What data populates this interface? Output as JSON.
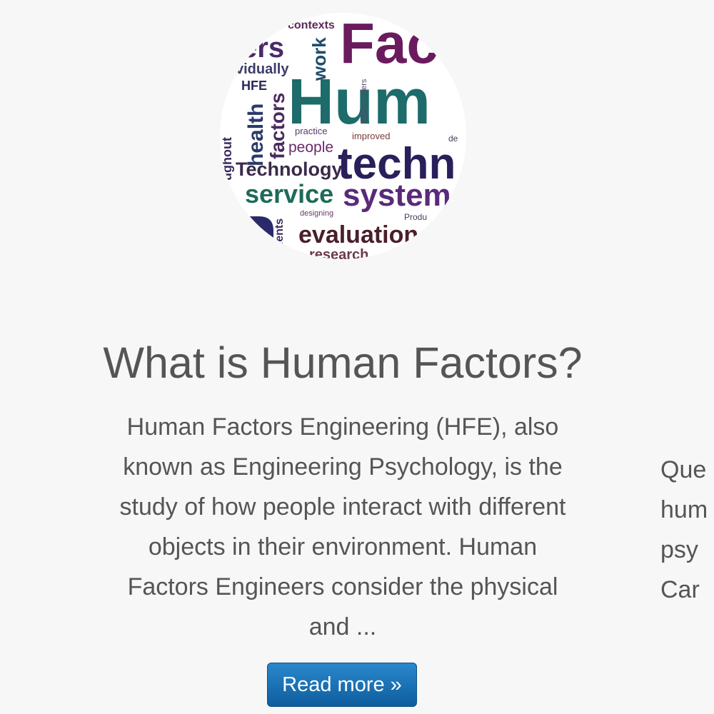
{
  "colors": {
    "page_background": "#f7f7f7",
    "text": "#555555",
    "button": "#1b71b4",
    "button_text": "#ffffff"
  },
  "featured": {
    "image": {
      "type": "word-cloud",
      "words": [
        "contexts",
        "Fac",
        "ers",
        "work",
        "vidually",
        "HFE",
        "Hum",
        "stakeholders",
        "health",
        "factors",
        "practice",
        "improved",
        "people",
        "Technology",
        "techn",
        "ughout",
        "service",
        "system",
        "designing",
        "Produ",
        "ments",
        "evaluation",
        "research",
        "de"
      ]
    },
    "title": "What is Human Factors?",
    "body_lines": [
      "Human Factors Engineering (HFE), also",
      "known as Engineering Psychology, is the",
      "study of how people interact with different",
      "objects in their environment. Human",
      "Factors Engineers consider the physical",
      "and ..."
    ],
    "read_more_label": "Read more »"
  },
  "next_card": {
    "lines": [
      "Que",
      "hum",
      "psy",
      "Car"
    ]
  }
}
